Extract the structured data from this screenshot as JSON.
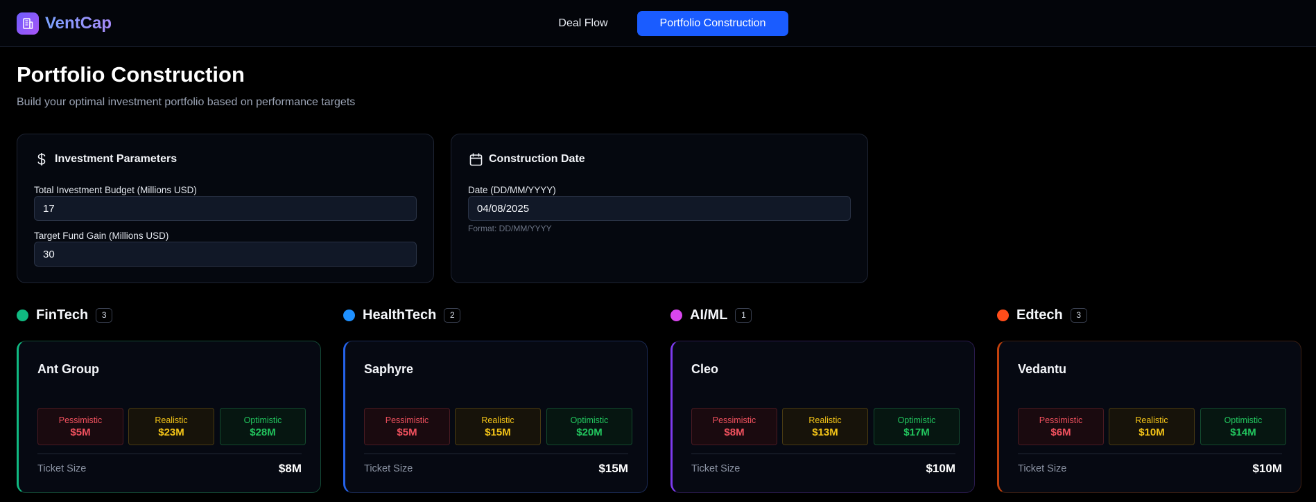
{
  "app": {
    "name": "VentCap",
    "logo_icon": "building-icon",
    "brand_gradient": [
      "#6d5dfc",
      "#a855f7"
    ]
  },
  "nav": {
    "tabs": [
      {
        "label": "Deal Flow",
        "active": false
      },
      {
        "label": "Portfolio Construction",
        "active": true
      }
    ],
    "active_color": "#1a5cff"
  },
  "page": {
    "title": "Portfolio Construction",
    "subtitle": "Build your optimal investment portfolio based on performance targets"
  },
  "investment_parameters": {
    "title": "Investment Parameters",
    "icon": "dollar-icon",
    "budget_label": "Total Investment Budget (Millions USD)",
    "budget_value": "17",
    "gain_label": "Target Fund Gain (Millions USD)",
    "gain_value": "30"
  },
  "construction_date": {
    "title": "Construction Date",
    "icon": "calendar-icon",
    "date_label": "Date (DD/MM/YYYY)",
    "date_value": "04/08/2025",
    "hint": "Format: DD/MM/YYYY"
  },
  "scenario_labels": {
    "pessimistic": "Pessimistic",
    "realistic": "Realistic",
    "optimistic": "Optimistic",
    "ticket": "Ticket Size"
  },
  "sectors": [
    {
      "name": "FinTech",
      "count": "3",
      "color": "#10b981",
      "card": {
        "company": "Ant Group",
        "pessimistic": "$5M",
        "realistic": "$23M",
        "optimistic": "$28M",
        "ticket": "$8M"
      },
      "border": "#134a35",
      "accent": "#10b981"
    },
    {
      "name": "HealthTech",
      "count": "2",
      "color": "#1e90ff",
      "card": {
        "company": "Saphyre",
        "pessimistic": "$5M",
        "realistic": "$15M",
        "optimistic": "$20M",
        "ticket": "$15M"
      },
      "border": "#1a2a55",
      "accent": "#2563eb"
    },
    {
      "name": "AI/ML",
      "count": "1",
      "color": "#d946ef",
      "card": {
        "company": "Cleo",
        "pessimistic": "$8M",
        "realistic": "$13M",
        "optimistic": "$17M",
        "ticket": "$10M"
      },
      "border": "#2a1a4d",
      "accent": "#7c3aed"
    },
    {
      "name": "Edtech",
      "count": "3",
      "color": "#ff4d1a",
      "card": {
        "company": "Vedantu",
        "pessimistic": "$6M",
        "realistic": "$10M",
        "optimistic": "$14M",
        "ticket": "$10M"
      },
      "border": "#3d1f12",
      "accent": "#c2410c"
    }
  ]
}
